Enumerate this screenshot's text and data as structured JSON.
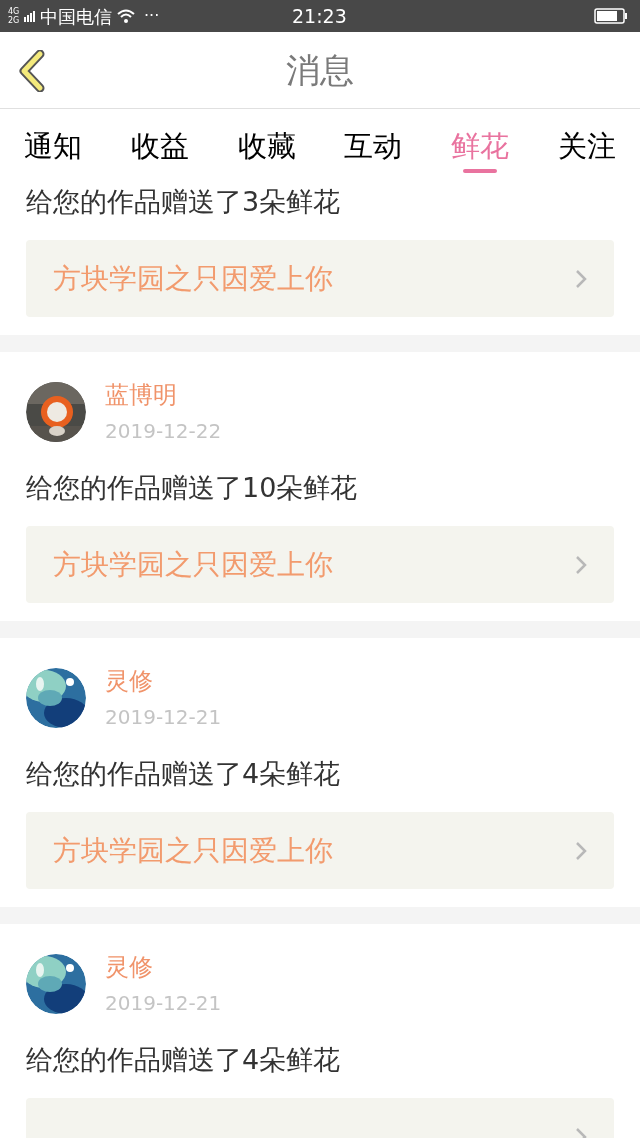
{
  "status_bar": {
    "network": "4G 2G",
    "carrier": "中国电信",
    "more": "···",
    "time": "21:23"
  },
  "header": {
    "title": "消息"
  },
  "tabs": [
    {
      "label": "通知",
      "selected": false
    },
    {
      "label": "收益",
      "selected": false
    },
    {
      "label": "收藏",
      "selected": false
    },
    {
      "label": "互动",
      "selected": false
    },
    {
      "label": "鲜花",
      "selected": true
    },
    {
      "label": "关注",
      "selected": false
    }
  ],
  "messages": [
    {
      "text": "给您的作品赠送了3朵鲜花",
      "work": "方块学园之只因爱上你"
    },
    {
      "name": "蓝博明",
      "date": "2019-12-22",
      "text": "给您的作品赠送了10朵鲜花",
      "work": "方块学园之只因爱上你"
    },
    {
      "name": "灵修",
      "date": "2019-12-21",
      "text": "给您的作品赠送了4朵鲜花",
      "work": "方块学园之只因爱上你"
    },
    {
      "name": "灵修",
      "date": "2019-12-21",
      "text": "给您的作品赠送了4朵鲜花"
    }
  ]
}
